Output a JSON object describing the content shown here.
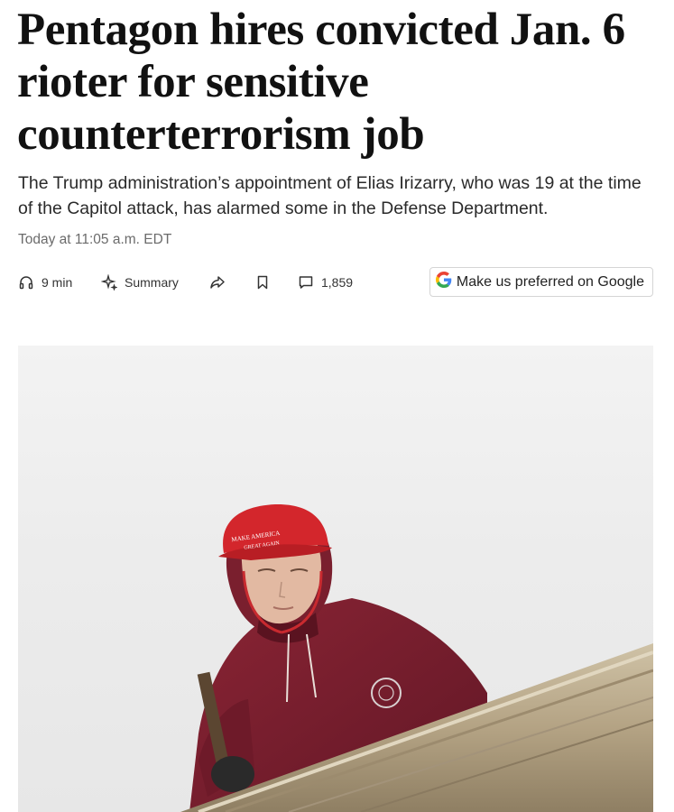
{
  "article": {
    "headline": "Pentagon hires convicted Jan. 6 rioter for sensitive counterterrorism job",
    "dek": "The Trump administration’s appointment of Elias Irizarry, who was 19 at the time of the Capitol attack, has alarmed some in the Defense Department.",
    "timestamp": "Today at 11:05 a.m. EDT"
  },
  "toolbar": {
    "listen_label": "9 min",
    "summary_label": "Summary",
    "comments_count": "1,859",
    "google_button_label": "Make us preferred on Google",
    "icons": [
      "headphones-icon",
      "sparkle-icon",
      "share-icon",
      "bookmark-icon",
      "comment-icon",
      "google-logo-icon"
    ]
  },
  "photo": {
    "hat_text": "MAKE AMERICA GREAT AGAIN",
    "colors": {
      "sky": "#ececec",
      "hat": "#d3262c",
      "hoodie": "#7a1f2e",
      "ledge": "#b9a98d"
    }
  }
}
